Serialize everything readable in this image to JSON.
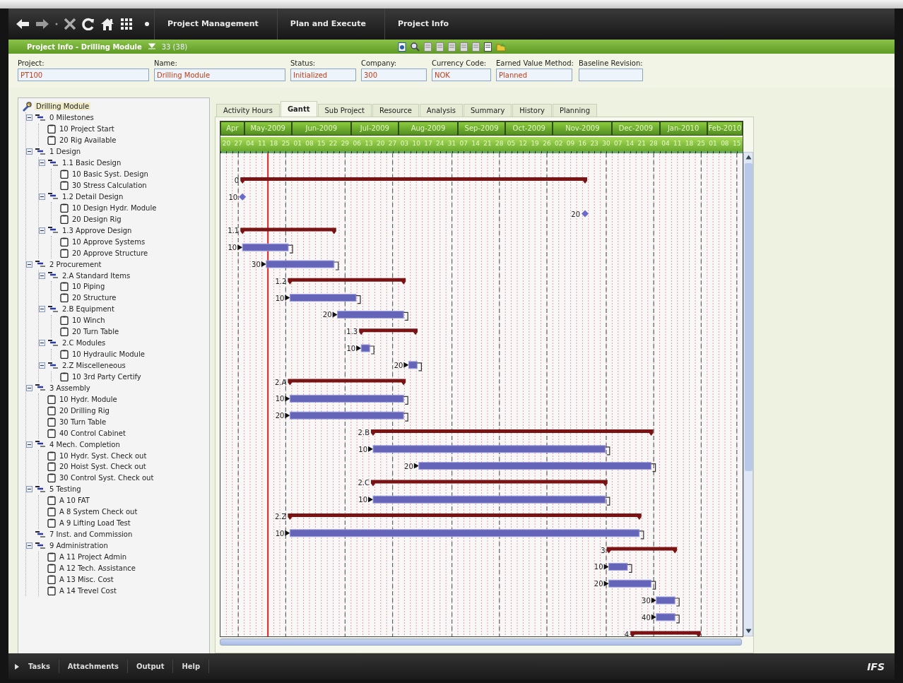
{
  "nav": {
    "breadcrumbs": [
      "Project Management",
      "Plan and Execute",
      "Project Info"
    ]
  },
  "header": {
    "title": "Project Info - Drilling Module",
    "count": "33 (38)"
  },
  "fields": [
    {
      "label": "Project:",
      "value": "PT100"
    },
    {
      "label": "Name:",
      "value": "Drilling Module"
    },
    {
      "label": "Status:",
      "value": "Initialized"
    },
    {
      "label": "Company:",
      "value": "300"
    },
    {
      "label": "Currency Code:",
      "value": "NOK"
    },
    {
      "label": "Earned Value Method:",
      "value": "Planned"
    },
    {
      "label": "Baseline Revision:"
    }
  ],
  "tree": {
    "label": "Drilling Module",
    "kind": "root",
    "selected": true,
    "children": [
      {
        "label": "0 Milestones",
        "kind": "group",
        "expanded": true,
        "selected": false,
        "children": [
          {
            "label": "10 Project Start",
            "kind": "activity",
            "selected": false
          },
          {
            "label": "20 Rig Available",
            "kind": "activity",
            "selected": false
          }
        ]
      },
      {
        "label": "1 Design",
        "kind": "group",
        "expanded": true,
        "selected": false,
        "children": [
          {
            "label": "1.1 Basic Design",
            "kind": "group",
            "expanded": true,
            "selected": false,
            "children": [
              {
                "label": "10 Basic Syst. Design",
                "kind": "activity",
                "selected": false
              },
              {
                "label": "30 Stress Calculation",
                "kind": "activity",
                "selected": false
              }
            ]
          },
          {
            "label": "1.2 Detail Design",
            "kind": "group",
            "expanded": true,
            "selected": false,
            "children": [
              {
                "label": "10 Design Hydr. Module",
                "kind": "activity",
                "selected": false
              },
              {
                "label": "20 Design Rig",
                "kind": "activity",
                "selected": false
              }
            ]
          },
          {
            "label": "1.3 Approve Design",
            "kind": "group",
            "expanded": true,
            "selected": false,
            "children": [
              {
                "label": "10 Approve Systems",
                "kind": "activity",
                "selected": false
              },
              {
                "label": "20 Approve Structure",
                "kind": "activity",
                "selected": false
              }
            ]
          }
        ]
      },
      {
        "label": "2 Procurement",
        "kind": "group",
        "expanded": true,
        "selected": false,
        "children": [
          {
            "label": "2.A Standard Items",
            "kind": "group",
            "expanded": true,
            "selected": false,
            "children": [
              {
                "label": "10 Piping",
                "kind": "activity",
                "selected": false
              },
              {
                "label": "20 Structure",
                "kind": "activity",
                "selected": false
              }
            ]
          },
          {
            "label": "2.B Equipment",
            "kind": "group",
            "expanded": true,
            "selected": false,
            "children": [
              {
                "label": "10 Winch",
                "kind": "activity",
                "selected": false
              },
              {
                "label": "20 Turn Table",
                "kind": "activity",
                "selected": false
              }
            ]
          },
          {
            "label": "2.C Modules",
            "kind": "group",
            "expanded": true,
            "selected": false,
            "children": [
              {
                "label": "10 Hydraulic Module",
                "kind": "activity",
                "selected": false
              }
            ]
          },
          {
            "label": "2.Z Miscelleneous",
            "kind": "group",
            "expanded": true,
            "selected": false,
            "children": [
              {
                "label": "10 3rd Party Certify",
                "kind": "activity",
                "selected": false
              }
            ]
          }
        ]
      },
      {
        "label": "3 Assembly",
        "kind": "group",
        "expanded": true,
        "selected": false,
        "children": [
          {
            "label": "10 Hydr. Module",
            "kind": "activity",
            "selected": false
          },
          {
            "label": "20 Drilling Rig",
            "kind": "activity",
            "selected": false
          },
          {
            "label": "30 Turn Table",
            "kind": "activity",
            "selected": false
          },
          {
            "label": "40 Control Cabinet",
            "kind": "activity",
            "selected": false
          }
        ]
      },
      {
        "label": "4 Mech. Completion",
        "kind": "group",
        "expanded": true,
        "selected": false,
        "children": [
          {
            "label": "10 Hydr. Syst. Check out",
            "kind": "activity",
            "selected": false
          },
          {
            "label": "20 Hoist Syst. Check out",
            "kind": "activity",
            "selected": false
          },
          {
            "label": "30 Control Syst. Check out",
            "kind": "activity",
            "selected": false
          }
        ]
      },
      {
        "label": "5 Testing",
        "kind": "group",
        "expanded": true,
        "selected": false,
        "children": [
          {
            "label": "A 10 FAT",
            "kind": "activity",
            "selected": false
          },
          {
            "label": "A 8 System Check out",
            "kind": "activity",
            "selected": false
          },
          {
            "label": "A 9 Lifting Load Test",
            "kind": "activity",
            "selected": false
          }
        ]
      },
      {
        "label": "7 Inst. and Commission",
        "kind": "group",
        "selected": false
      },
      {
        "label": "9 Administration",
        "kind": "group",
        "expanded": true,
        "selected": false,
        "children": [
          {
            "label": "A 11 Project Admin",
            "kind": "activity",
            "selected": false
          },
          {
            "label": "A 12 Tech. Assistance",
            "kind": "activity",
            "selected": false
          },
          {
            "label": "A 13 Misc. Cost",
            "kind": "activity",
            "selected": false
          },
          {
            "label": "A 14 Trevel Cost",
            "kind": "activity",
            "selected": false
          }
        ]
      }
    ]
  },
  "tabs": [
    {
      "label": "Activity Hours",
      "selected": false
    },
    {
      "label": "Gantt",
      "selected": true
    },
    {
      "label": "Sub Project",
      "selected": false
    },
    {
      "label": "Resource",
      "selected": false
    },
    {
      "label": "Analysis",
      "selected": false
    },
    {
      "label": "Summary",
      "selected": false
    },
    {
      "label": "History",
      "selected": false
    },
    {
      "label": "Planning",
      "selected": false
    }
  ],
  "gantt": {
    "months": [
      {
        "label": "Apr",
        "weeks": [
          "20",
          "27"
        ]
      },
      {
        "label": "May-2009",
        "weeks": [
          "04",
          "11",
          "18",
          "25"
        ]
      },
      {
        "label": "Jun-2009",
        "weeks": [
          "01",
          "08",
          "15",
          "22",
          "29"
        ]
      },
      {
        "label": "Jul-2009",
        "weeks": [
          "06",
          "13",
          "20",
          "27"
        ]
      },
      {
        "label": "Aug-2009",
        "weeks": [
          "03",
          "10",
          "17",
          "24",
          "31"
        ]
      },
      {
        "label": "Sep-2009",
        "weeks": [
          "07",
          "14",
          "21",
          "28"
        ]
      },
      {
        "label": "Oct-2009",
        "weeks": [
          "05",
          "12",
          "19",
          "26"
        ]
      },
      {
        "label": "Nov-2009",
        "weeks": [
          "02",
          "09",
          "16",
          "23",
          "30"
        ]
      },
      {
        "label": "Dec-2009",
        "weeks": [
          "07",
          "14",
          "21",
          "28"
        ]
      },
      {
        "label": "Jan-2010",
        "weeks": [
          "04",
          "11",
          "18",
          "25"
        ]
      },
      {
        "label": "Feb-2010",
        "weeks": [
          "01",
          "08",
          "15"
        ]
      }
    ],
    "rows": [
      {
        "label": "0",
        "kind": "summary"
      },
      {
        "label": "10",
        "kind": "milestone"
      },
      {
        "label": "20",
        "kind": "milestone"
      },
      {
        "label": "1.1",
        "kind": "summary"
      },
      {
        "label": "10",
        "kind": "task"
      },
      {
        "label": "30",
        "kind": "task"
      },
      {
        "label": "1.2",
        "kind": "summary"
      },
      {
        "label": "10",
        "kind": "task"
      },
      {
        "label": "20",
        "kind": "task"
      },
      {
        "label": "1.3",
        "kind": "summary"
      },
      {
        "label": "10",
        "kind": "task"
      },
      {
        "label": "20",
        "kind": "task"
      },
      {
        "label": "2.A",
        "kind": "summary"
      },
      {
        "label": "10",
        "kind": "task"
      },
      {
        "label": "20",
        "kind": "task"
      },
      {
        "label": "2.B",
        "kind": "summary"
      },
      {
        "label": "10",
        "kind": "task"
      },
      {
        "label": "20",
        "kind": "task"
      },
      {
        "label": "2.C",
        "kind": "summary"
      },
      {
        "label": "10",
        "kind": "task"
      },
      {
        "label": "2.Z",
        "kind": "summary"
      },
      {
        "label": "10",
        "kind": "task"
      },
      {
        "label": "3",
        "kind": "summary"
      },
      {
        "label": "10",
        "kind": "task"
      },
      {
        "label": "20",
        "kind": "task"
      },
      {
        "label": "30",
        "kind": "task"
      },
      {
        "label": "40",
        "kind": "task"
      },
      {
        "label": "4",
        "kind": "summary"
      }
    ]
  },
  "bottom_tabs": [
    {
      "label": "Tasks"
    },
    {
      "label": "Attachments"
    },
    {
      "label": "Output"
    },
    {
      "label": "Help"
    }
  ],
  "logo": "IFS"
}
